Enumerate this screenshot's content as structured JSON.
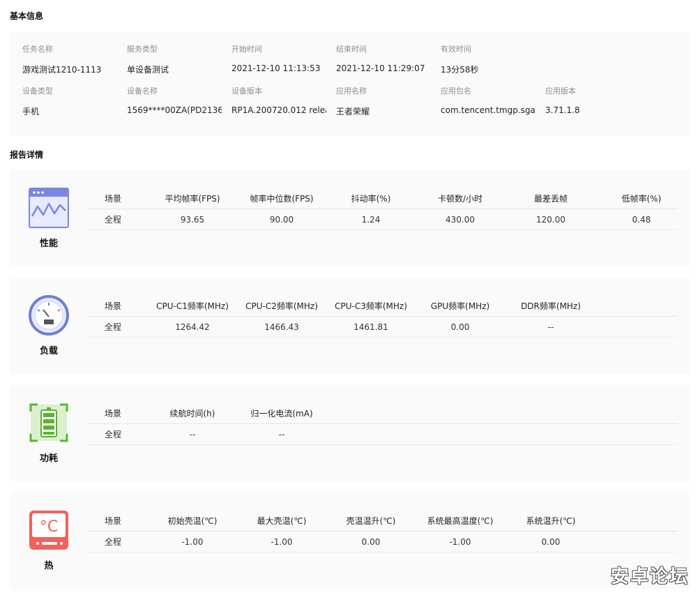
{
  "basic_info": {
    "title": "基本信息",
    "fields": [
      {
        "label": "任务名称",
        "value": "游戏测试1210-1113"
      },
      {
        "label": "服务类型",
        "value": "单设备测试"
      },
      {
        "label": "开始时间",
        "value": "2021-12-10 11:13:53"
      },
      {
        "label": "结束时间",
        "value": "2021-12-10 11:29:07"
      },
      {
        "label": "有效时间",
        "value": "13分58秒"
      },
      {
        "label": "设备类型",
        "value": "手机"
      },
      {
        "label": "设备名称",
        "value": "1569****00ZA(PD2136"
      },
      {
        "label": "设备版本",
        "value": "RP1A.200720.012 relea"
      },
      {
        "label": "应用名称",
        "value": "王者荣耀"
      },
      {
        "label": "应用包名",
        "value": "com.tencent.tmgp.sgam"
      },
      {
        "label": "应用版本",
        "value": "3.71.1.8"
      }
    ]
  },
  "report": {
    "title": "报告详情",
    "sections": [
      {
        "label": "性能",
        "icon": "performance-chart-icon",
        "headers": [
          "场景",
          "平均帧率(FPS)",
          "帧率中位数(FPS)",
          "抖动率(%)",
          "卡顿数/小时",
          "最差丢帧",
          "低帧率(%)"
        ],
        "row": [
          "全程",
          "93.65",
          "90.00",
          "1.24",
          "430.00",
          "120.00",
          "0.48"
        ]
      },
      {
        "label": "负载",
        "icon": "gauge-icon",
        "headers": [
          "场景",
          "CPU-C1频率(MHz)",
          "CPU-C2频率(MHz)",
          "CPU-C3频率(MHz)",
          "GPU频率(MHz)",
          "DDR频率(MHz)"
        ],
        "row": [
          "全程",
          "1264.42",
          "1466.43",
          "1461.81",
          "0.00",
          "--"
        ]
      },
      {
        "label": "功耗",
        "icon": "battery-icon",
        "headers": [
          "场景",
          "续航时间(h)",
          "归一化电流(mA)"
        ],
        "row": [
          "全程",
          "--",
          "--"
        ]
      },
      {
        "label": "热",
        "icon": "thermometer-celsius-icon",
        "icon_text": "°C",
        "headers": [
          "场景",
          "初始壳温(℃)",
          "最大壳温(℃)",
          "壳温温升(℃)",
          "系统最高温度(℃)",
          "系统温升(℃)"
        ],
        "row": [
          "全程",
          "-1.00",
          "-1.00",
          "0.00",
          "-1.00",
          "0.00"
        ]
      }
    ]
  },
  "watermark": "安卓论坛",
  "colors": {
    "performance": "#7b86e0",
    "gauge": "#6e7fd6",
    "battery": "#5ab52e",
    "thermal": "#f0625c"
  }
}
